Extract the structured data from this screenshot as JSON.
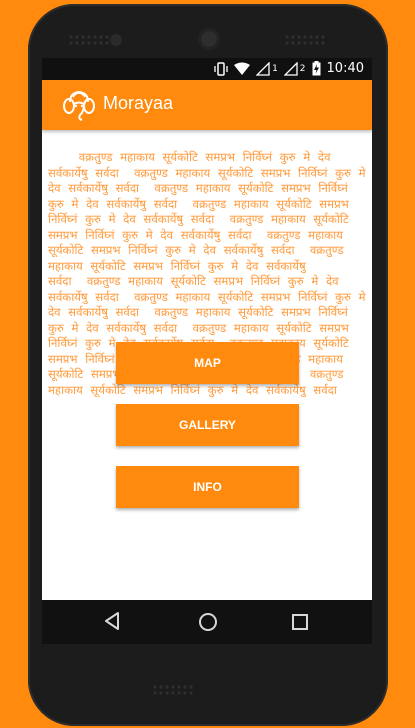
{
  "status_bar": {
    "time": "10:40",
    "sim1_label": "1",
    "sim2_label": "2",
    "icons": [
      "vibrate-icon",
      "wifi-icon",
      "signal-icon",
      "battery-charging-icon"
    ]
  },
  "app_bar": {
    "title": "Morayaa",
    "logo_icon": "ganesha-icon"
  },
  "background_mantra": "वक्रतुण्ड महाकाय सूर्यकोटि समप्रभ निर्विघ्नं कुरु मे देव सर्वकार्येषु सर्वदा",
  "menu": {
    "map_label": "MAP",
    "gallery_label": "GALLERY",
    "info_label": "INFO"
  },
  "colors": {
    "accent": "#ff8a0d",
    "text_pattern": "#ff9b3d"
  },
  "nav_bar": {
    "icons": [
      "back-icon",
      "home-icon",
      "recents-icon"
    ]
  }
}
